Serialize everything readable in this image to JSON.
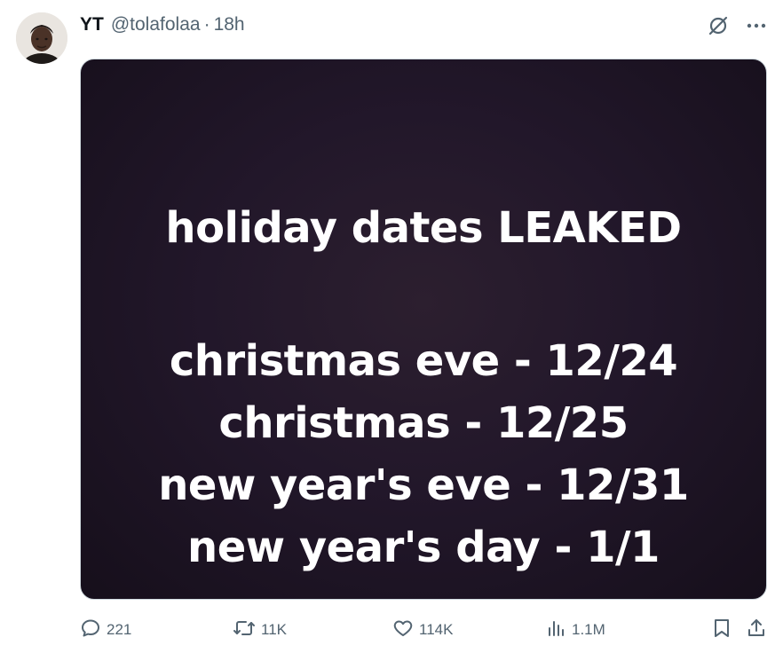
{
  "post": {
    "author_name": "YT",
    "author_handle": "@tolafolaa",
    "separator": "·",
    "time": "18h"
  },
  "media": {
    "title": "holiday dates LEAKED",
    "lines": [
      "christmas eve - 12/24",
      "christmas - 12/25",
      "new year's eve - 12/31",
      "new year's day - 1/1"
    ]
  },
  "actions": {
    "replies": "221",
    "reposts": "11K",
    "likes": "114K",
    "views": "1.1M"
  },
  "icons": {
    "grok": "grok-icon",
    "more": "more-icon",
    "reply": "reply-icon",
    "repost": "repost-icon",
    "like": "heart-icon",
    "views": "views-icon",
    "bookmark": "bookmark-icon",
    "share": "share-icon"
  },
  "colors": {
    "text_primary": "#0f1419",
    "text_secondary": "#536471",
    "media_background": "#22172a",
    "media_text": "#ffffff"
  }
}
